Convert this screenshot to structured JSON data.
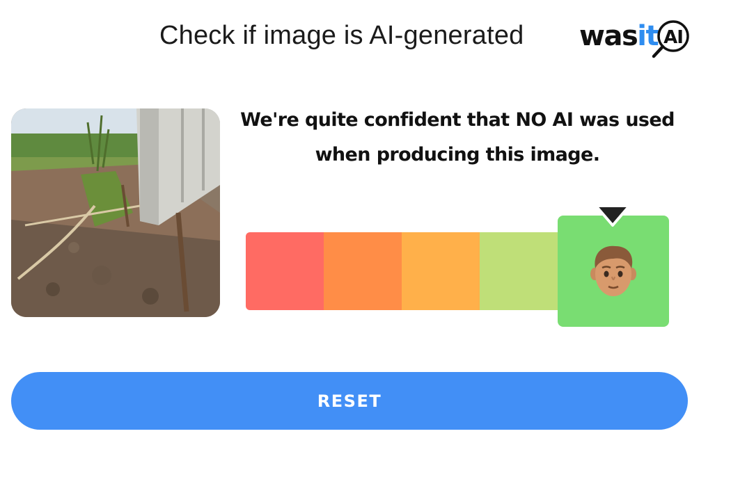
{
  "header": {
    "title": "Check if image is AI-generated"
  },
  "logo": {
    "text_was": "was",
    "text_it": "it",
    "text_ai": "AI",
    "icon": "magnifier-icon"
  },
  "result": {
    "image_alt": "Uploaded photo of a concrete fence beside a dirt field",
    "verdict": "We're quite confident that NO AI was used when producing this image."
  },
  "meter": {
    "segment_colors": [
      "#ff6b63",
      "#ff8d47",
      "#ffb04a",
      "#bfdf78",
      "#79dd72"
    ],
    "active_index": 4,
    "active_icon": "human-face-icon"
  },
  "actions": {
    "reset_label": "RESET"
  },
  "colors": {
    "accent": "#428ff6",
    "logo_blue": "#2f8df0"
  }
}
